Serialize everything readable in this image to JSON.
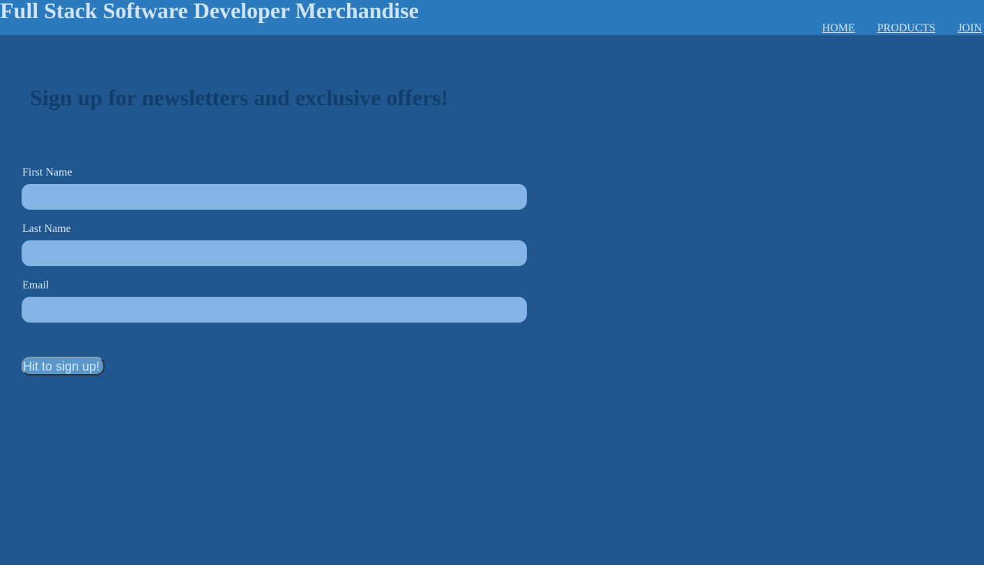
{
  "header": {
    "title": "Full Stack Software Developer Merchandise",
    "nav": [
      {
        "label": "HOME"
      },
      {
        "label": "PRODUCTS"
      },
      {
        "label": "JOIN"
      }
    ]
  },
  "main": {
    "heading": "Sign up for newsletters and exclusive offers!",
    "form": {
      "first_name": {
        "label": "First Name",
        "value": ""
      },
      "last_name": {
        "label": "Last Name",
        "value": ""
      },
      "email": {
        "label": "Email",
        "value": ""
      },
      "submit_label": "Hit to sign up!"
    }
  },
  "colors": {
    "page_background": "#21578f",
    "header_background": "#2a7abd",
    "input_background": "#84b3e5",
    "heading_text": "#123e6b",
    "light_text": "#cfe4f7",
    "button_background": "#5b98c9"
  }
}
